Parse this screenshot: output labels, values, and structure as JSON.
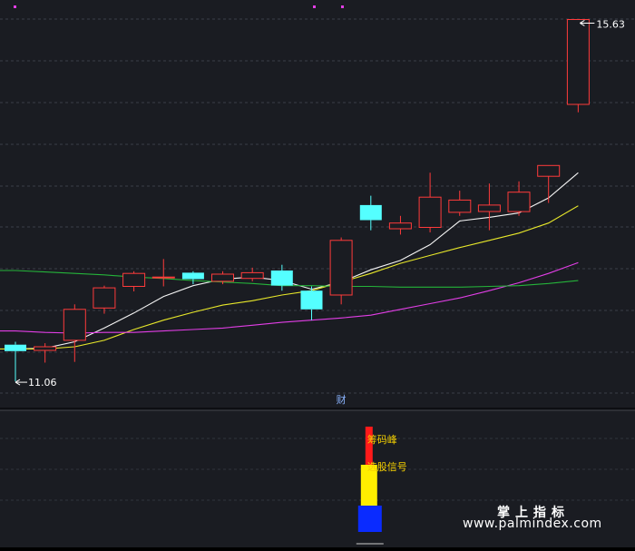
{
  "chart_data": {
    "type": "candlestick",
    "price_range": {
      "min": 10.5,
      "max": 15.8
    },
    "max_label": "15.63",
    "min_label": "11.06",
    "marker_label": "财",
    "candles": [
      {
        "o": 11.11,
        "h": 11.15,
        "l": 10.6,
        "c": 11.02
      },
      {
        "o": 11.03,
        "h": 11.13,
        "l": 10.86,
        "c": 11.08
      },
      {
        "o": 11.17,
        "h": 11.67,
        "l": 10.87,
        "c": 11.6
      },
      {
        "o": 11.62,
        "h": 11.93,
        "l": 11.54,
        "c": 11.9
      },
      {
        "o": 11.92,
        "h": 12.13,
        "l": 11.85,
        "c": 12.1
      },
      {
        "o": 12.05,
        "h": 12.3,
        "l": 11.92,
        "c": 12.05
      },
      {
        "o": 12.11,
        "h": 12.13,
        "l": 11.95,
        "c": 12.02
      },
      {
        "o": 11.99,
        "h": 12.13,
        "l": 11.95,
        "c": 12.09
      },
      {
        "o": 12.03,
        "h": 12.18,
        "l": 11.99,
        "c": 12.11
      },
      {
        "o": 12.14,
        "h": 12.22,
        "l": 11.86,
        "c": 11.93
      },
      {
        "o": 11.86,
        "h": 11.92,
        "l": 11.45,
        "c": 11.6
      },
      {
        "o": 11.8,
        "h": 12.6,
        "l": 11.67,
        "c": 12.56
      },
      {
        "o": 13.05,
        "h": 13.18,
        "l": 12.7,
        "c": 12.84
      },
      {
        "o": 12.72,
        "h": 12.9,
        "l": 12.64,
        "c": 12.8
      },
      {
        "o": 12.74,
        "h": 13.5,
        "l": 12.67,
        "c": 13.16
      },
      {
        "o": 12.95,
        "h": 13.25,
        "l": 12.9,
        "c": 13.12
      },
      {
        "o": 12.96,
        "h": 13.35,
        "l": 12.7,
        "c": 13.05
      },
      {
        "o": 12.96,
        "h": 13.38,
        "l": 12.9,
        "c": 13.23
      },
      {
        "o": 13.45,
        "h": 13.6,
        "l": 13.08,
        "c": 13.6
      },
      {
        "o": 14.45,
        "h": 15.63,
        "l": 14.34,
        "c": 15.63
      }
    ],
    "series": [
      {
        "color": "#f5f5f5",
        "values": [
          11.05,
          11.06,
          11.15,
          11.34,
          11.55,
          11.78,
          11.93,
          12.02,
          12.05,
          12.0,
          11.88,
          11.98,
          12.15,
          12.28,
          12.5,
          12.83,
          12.88,
          12.94,
          13.15,
          13.5
        ]
      },
      {
        "color": "#e8e82a",
        "values": [
          11.05,
          11.05,
          11.08,
          11.17,
          11.32,
          11.45,
          11.56,
          11.66,
          11.72,
          11.8,
          11.86,
          11.98,
          12.1,
          12.24,
          12.35,
          12.46,
          12.56,
          12.66,
          12.8,
          13.04
        ]
      },
      {
        "color": "#e23ee6",
        "values": [
          11.3,
          11.28,
          11.27,
          11.28,
          11.28,
          11.3,
          11.32,
          11.34,
          11.38,
          11.42,
          11.45,
          11.48,
          11.52,
          11.6,
          11.68,
          11.76,
          11.86,
          11.97,
          12.1,
          12.25
        ]
      },
      {
        "color": "#25b33a",
        "values": [
          12.14,
          12.12,
          12.1,
          12.08,
          12.05,
          12.03,
          12.0,
          11.98,
          11.96,
          11.93,
          11.93,
          11.92,
          11.92,
          11.91,
          11.91,
          11.91,
          11.92,
          11.93,
          11.96,
          12.0
        ]
      }
    ],
    "subchart": {
      "bar_index": 12,
      "segments": [
        {
          "name": "筹码峰",
          "color": "#ff1a1a",
          "label_color": "#f5d000"
        },
        {
          "name": "选股信号",
          "color": "#ffee00",
          "label_color": "#f5d000"
        },
        {
          "name": "",
          "color": "#0a2bff",
          "label_color": ""
        }
      ]
    }
  },
  "watermark": {
    "line1": "掌上指标",
    "line2": "www.palmindex.com"
  }
}
